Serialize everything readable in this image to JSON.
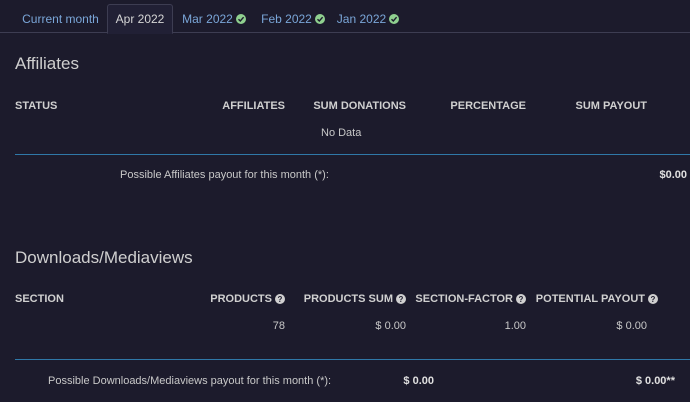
{
  "tabs": [
    {
      "label": "Current month",
      "active": false,
      "checked": false
    },
    {
      "label": "Apr 2022",
      "active": true,
      "checked": false
    },
    {
      "label": "Mar 2022",
      "active": false,
      "checked": true
    },
    {
      "label": "Feb 2022",
      "active": false,
      "checked": true
    },
    {
      "label": "Jan 2022",
      "active": false,
      "checked": true
    }
  ],
  "affiliates": {
    "title": "Affiliates",
    "columns": [
      "STATUS",
      "AFFILIATES",
      "SUM DONATIONS",
      "PERCENTAGE",
      "SUM PAYOUT"
    ],
    "empty_text": "No Data",
    "footer_label": "Possible Affiliates payout for this month (*):",
    "footer_value": "$0.00"
  },
  "downloads": {
    "title": "Downloads/Mediaviews",
    "columns": [
      "SECTION",
      "PRODUCTS",
      "PRODUCTS SUM",
      "SECTION-FACTOR",
      "POTENTIAL PAYOUT"
    ],
    "row": {
      "section": "",
      "products": "78",
      "products_sum": "$ 0.00",
      "section_factor": "1.00",
      "potential_payout": "$ 0.00"
    },
    "footer_label": "Possible Downloads/Mediaviews payout for this month (*):",
    "footer_products_sum": "$ 0.00",
    "footer_payout": "$ 0.00**"
  },
  "colors": {
    "background": "#1c1b2c",
    "link": "#7aa6d8",
    "divider": "#2f78a8",
    "check": "#8fd08f"
  }
}
